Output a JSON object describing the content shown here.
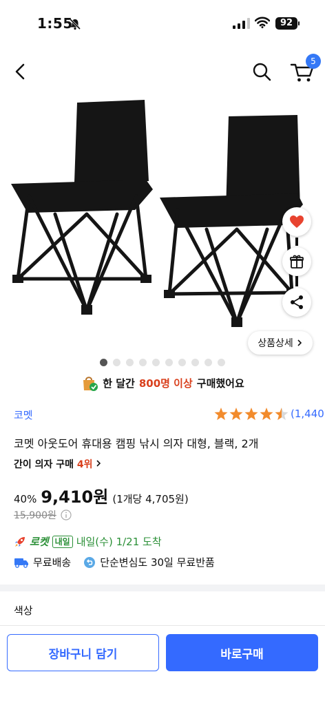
{
  "status": {
    "time": "1:55",
    "battery": "92"
  },
  "nav": {
    "cart_count": "5"
  },
  "gallery": {
    "total_images": 10,
    "active_index": 0,
    "detail_label": "상품상세"
  },
  "purchase_stats": {
    "prefix": "한 달간",
    "count": "800명 이상",
    "suffix": "구매했어요"
  },
  "product": {
    "brand": "코멧",
    "rating": 4.5,
    "review_count": "(1,440)",
    "title": "코멧 아웃도어 휴대용 캠핑 낚시 의자 대형, 블랙, 2개",
    "rank_category": "간이 의자 구매",
    "rank": "4위",
    "discount": "40%",
    "price": "9,410원",
    "unit_price": "(1개당 4,705원)",
    "original_price": "15,900원"
  },
  "delivery": {
    "rocket_label": "로켓",
    "rocket_tag": "내일",
    "arrival": "내일(수) 1/21 도착",
    "free_shipping": "무료배송",
    "free_return": "단순변심도 30일 무료반품"
  },
  "options": {
    "color_label": "색상"
  },
  "bottom_bar": {
    "add_to_cart": "장바구니 담기",
    "buy_now": "바로구매"
  },
  "colors": {
    "accent_blue": "#346aff",
    "rocket_green": "#2a8f36",
    "highlight_red": "#d9401d",
    "star_orange": "#f28b2c"
  }
}
